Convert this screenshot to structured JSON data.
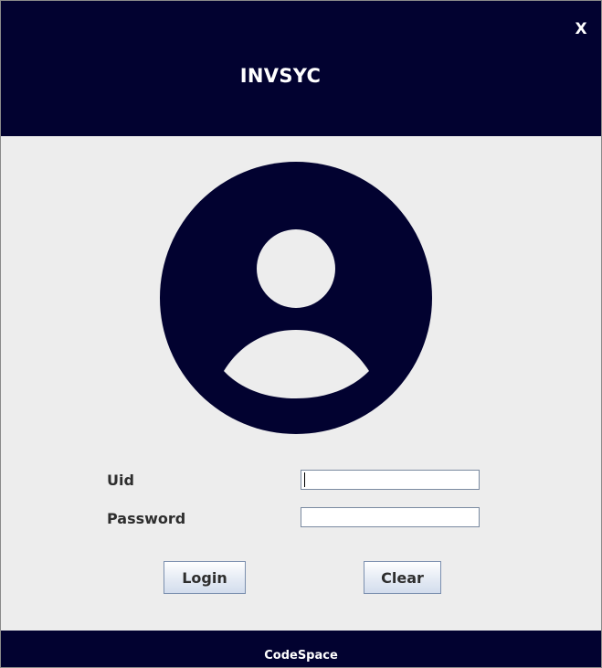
{
  "header": {
    "title": "INVSYC",
    "close_label": "X"
  },
  "avatar": {
    "icon": "user-avatar-icon"
  },
  "form": {
    "uid_label": "Uid",
    "uid_value": "",
    "password_label": "Password",
    "password_value": ""
  },
  "buttons": {
    "login_label": "Login",
    "clear_label": "Clear"
  },
  "footer": {
    "text": "CodeSpace"
  },
  "colors": {
    "brand_navy": "#020230",
    "panel_background": "#ededed",
    "text_white": "#ffffff"
  }
}
